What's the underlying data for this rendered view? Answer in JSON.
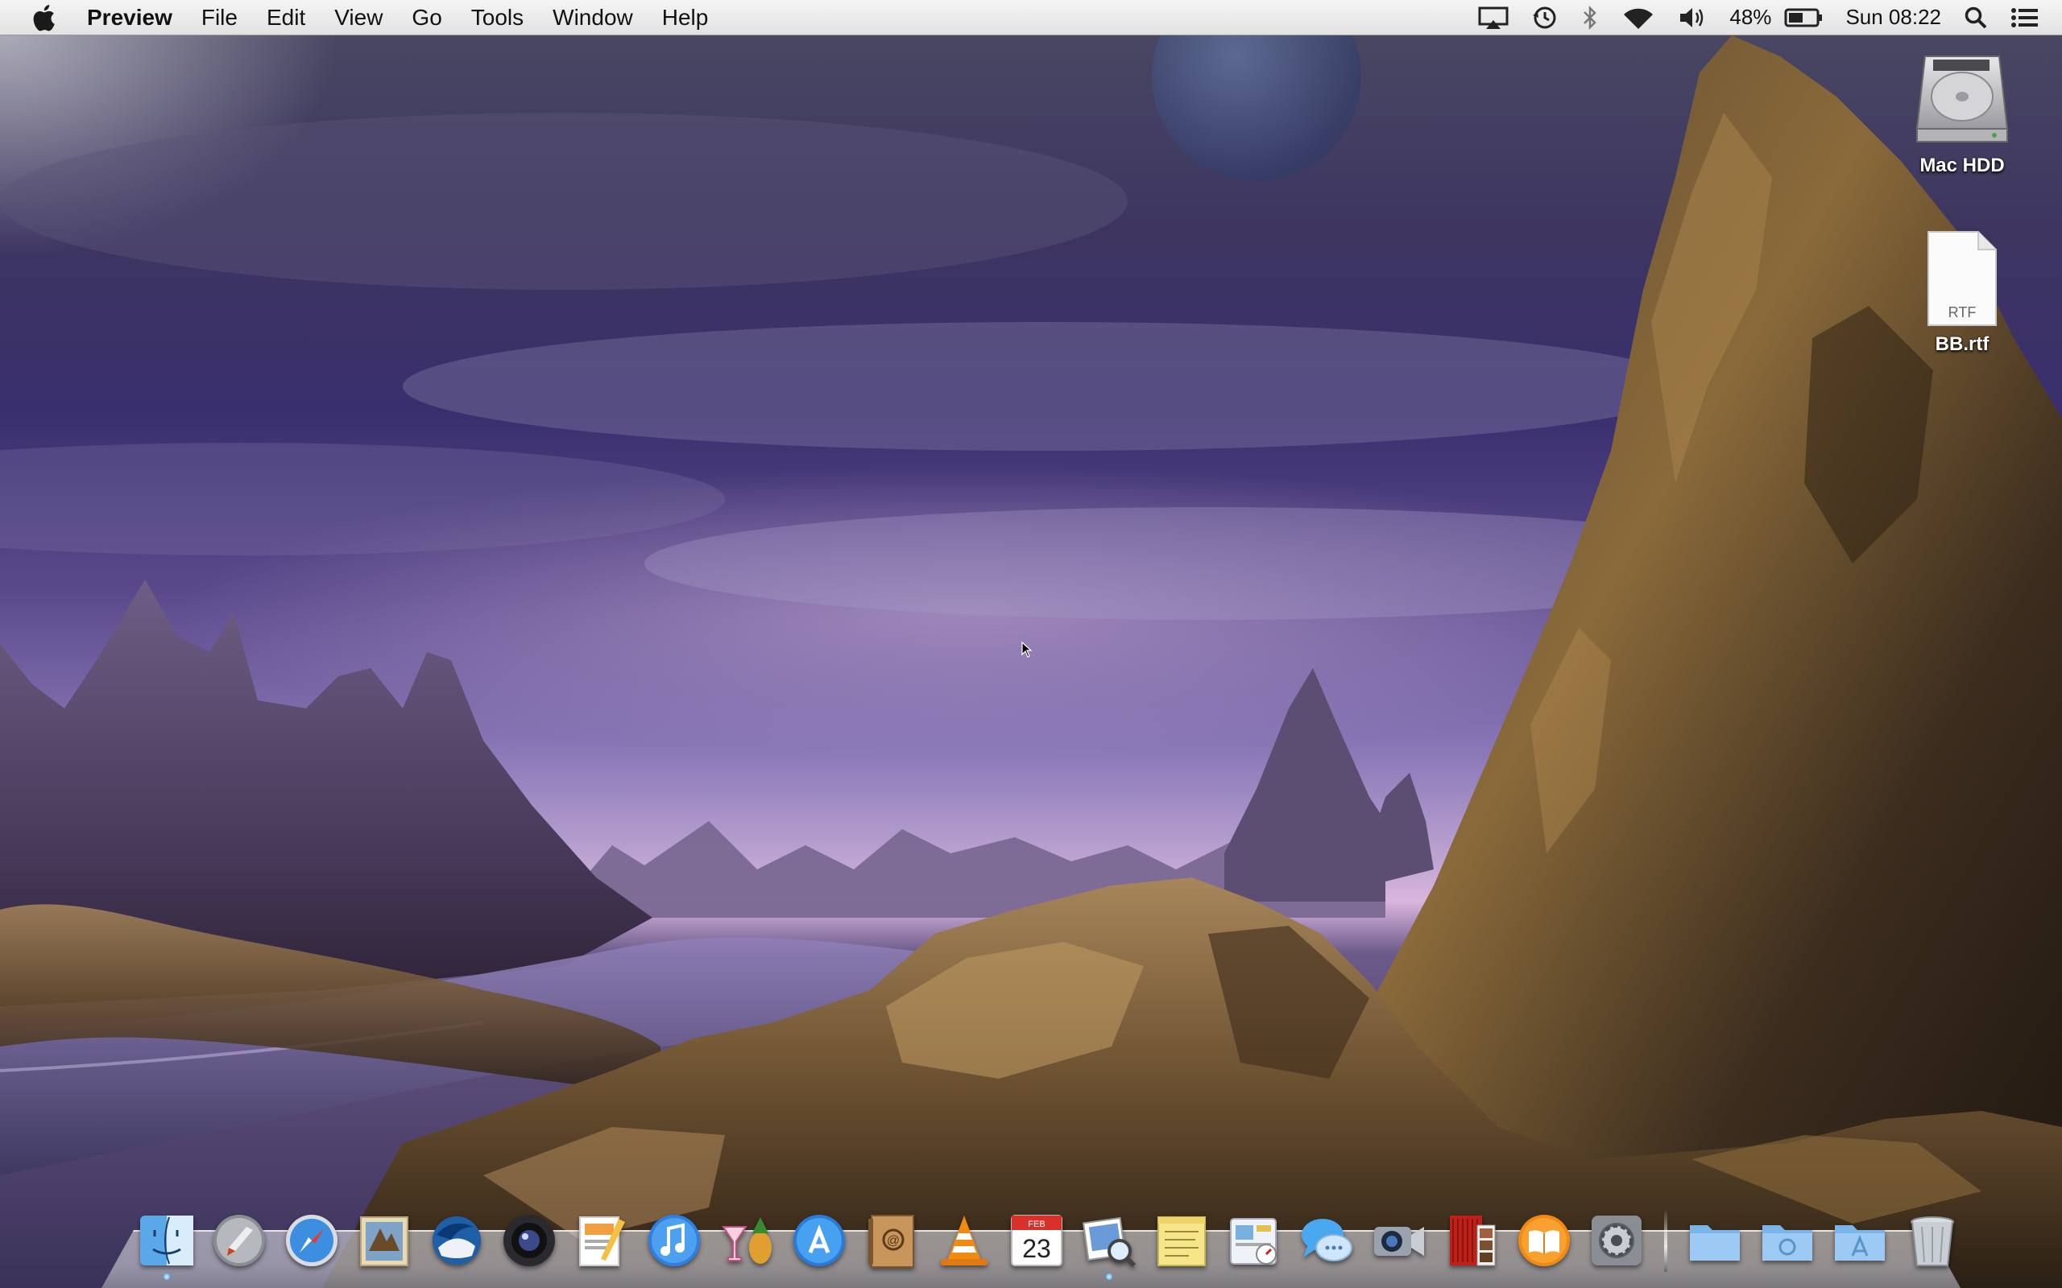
{
  "menubar": {
    "app_name": "Preview",
    "menus": [
      "File",
      "Edit",
      "View",
      "Go",
      "Tools",
      "Window",
      "Help"
    ],
    "status": {
      "battery_percent": "48%",
      "clock": "Sun 08:22",
      "icons": [
        "airplay-icon",
        "time-machine-icon",
        "bluetooth-icon",
        "wifi-icon",
        "volume-icon",
        "battery-icon",
        "spotlight-icon",
        "notification-center-icon"
      ]
    }
  },
  "desktop": {
    "icons": [
      {
        "label": "Mac HDD",
        "icon": "hard-drive-icon"
      },
      {
        "label": "BB.rtf",
        "icon": "rtf-document-icon",
        "badge": "RTF"
      }
    ]
  },
  "dock": {
    "apps": [
      {
        "name": "finder",
        "running": true
      },
      {
        "name": "launchpad",
        "running": false
      },
      {
        "name": "safari",
        "running": false
      },
      {
        "name": "mail",
        "running": false
      },
      {
        "name": "thunderbird",
        "running": false
      },
      {
        "name": "facetime",
        "running": false
      },
      {
        "name": "pages",
        "running": false
      },
      {
        "name": "itunes",
        "running": false
      },
      {
        "name": "adium",
        "running": false
      },
      {
        "name": "app-store",
        "running": false
      },
      {
        "name": "contacts",
        "running": false
      },
      {
        "name": "vlc",
        "running": false
      },
      {
        "name": "calendar",
        "running": false,
        "day": "23",
        "month": "FEB"
      },
      {
        "name": "preview",
        "running": true
      },
      {
        "name": "stickies",
        "running": false
      },
      {
        "name": "dashboard",
        "running": false
      },
      {
        "name": "messages",
        "running": false
      },
      {
        "name": "photo-booth",
        "running": false
      },
      {
        "name": "photo-booth-alt",
        "running": false
      },
      {
        "name": "ibooks",
        "running": false
      },
      {
        "name": "system-preferences",
        "running": false
      }
    ],
    "stacks": [
      "applications-folder",
      "documents-folder",
      "downloads-folder"
    ],
    "trash": "trash"
  },
  "colors": {
    "menubar_top": "#f4f4f4",
    "menubar_bottom": "#e2e2e2",
    "sky_purple": "#3a2f6e",
    "mountain_gold": "#8a6a3a"
  }
}
